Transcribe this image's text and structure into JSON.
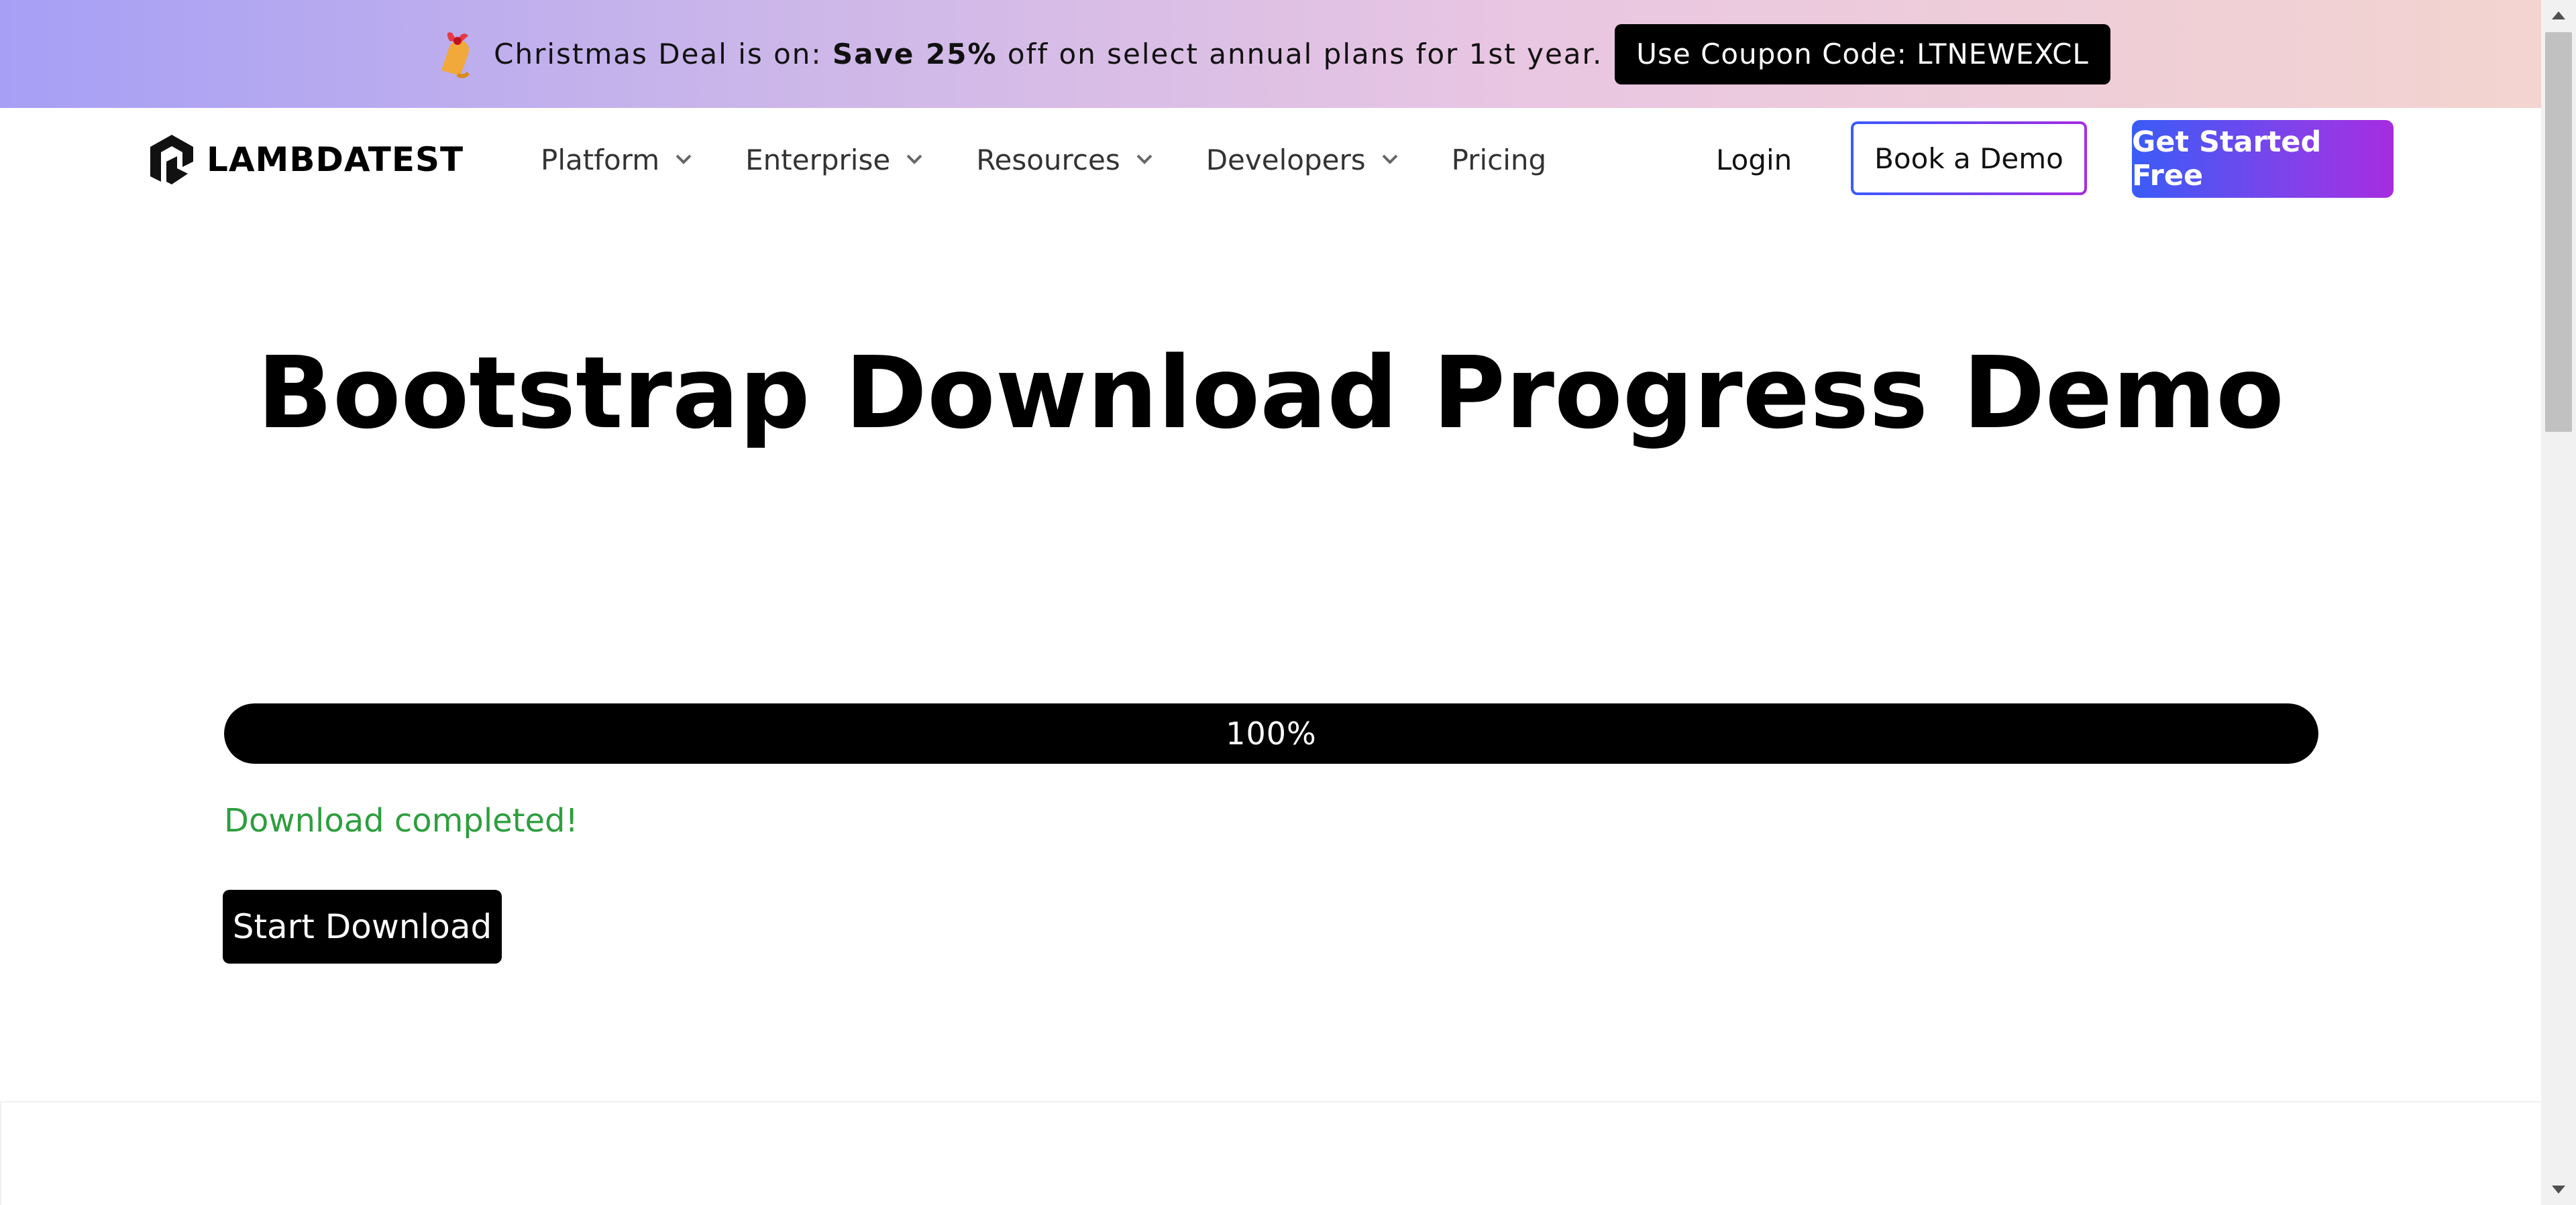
{
  "promo": {
    "text_prefix": "Christmas Deal is on: ",
    "text_bold": "Save 25%",
    "text_suffix": " off on select annual plans for 1st year.",
    "coupon_label": "Use Coupon Code: LTNEWEXCL",
    "icon": "bell-icon"
  },
  "nav": {
    "logo_text": "LAMBDATEST",
    "items": [
      {
        "label": "Platform",
        "has_dropdown": true
      },
      {
        "label": "Enterprise",
        "has_dropdown": true
      },
      {
        "label": "Resources",
        "has_dropdown": true
      },
      {
        "label": "Developers",
        "has_dropdown": true
      },
      {
        "label": "Pricing",
        "has_dropdown": false
      }
    ],
    "login_label": "Login",
    "book_demo_label": "Book a Demo",
    "get_started_label": "Get Started Free"
  },
  "hero": {
    "title": "Bootstrap Download Progress Demo"
  },
  "progress": {
    "value": 100,
    "label": "100%",
    "status_text": "Download completed!",
    "button_label": "Start Download"
  },
  "colors": {
    "accent_blue": "#3a5cf7",
    "accent_purple": "#a62ce0",
    "status_green": "#2e9e3e",
    "progress_fill": "#000000"
  }
}
